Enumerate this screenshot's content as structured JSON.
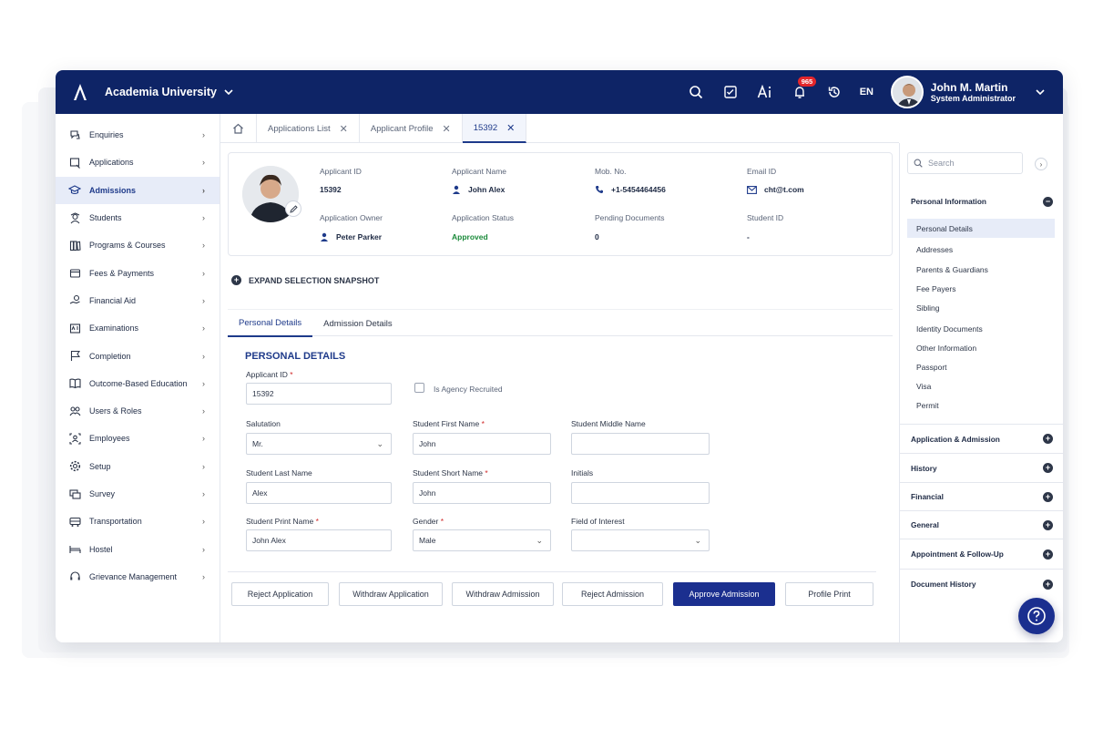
{
  "brand": {
    "name": "Academia University"
  },
  "header": {
    "lang": "EN",
    "notification_count": "965"
  },
  "user": {
    "name": "John M. Martin",
    "role": "System Administrator"
  },
  "sidebar": {
    "items": [
      {
        "label": "Enquiries",
        "icon": "enquiry-icon"
      },
      {
        "label": "Applications",
        "icon": "applications-icon"
      },
      {
        "label": "Admissions",
        "icon": "graduation-cap-icon",
        "active": true
      },
      {
        "label": "Students",
        "icon": "students-icon"
      },
      {
        "label": "Programs & Courses",
        "icon": "books-icon"
      },
      {
        "label": "Fees & Payments",
        "icon": "wallet-icon"
      },
      {
        "label": "Financial Aid",
        "icon": "hand-coin-icon"
      },
      {
        "label": "Examinations",
        "icon": "exam-icon"
      },
      {
        "label": "Completion",
        "icon": "flag-icon"
      },
      {
        "label": "Outcome-Based Education",
        "icon": "book-icon"
      },
      {
        "label": "Users & Roles",
        "icon": "users-icon"
      },
      {
        "label": "Employees",
        "icon": "employee-icon"
      },
      {
        "label": "Setup",
        "icon": "gear-icon"
      },
      {
        "label": "Survey",
        "icon": "survey-icon"
      },
      {
        "label": "Transportation",
        "icon": "bus-icon"
      },
      {
        "label": "Hostel",
        "icon": "bed-icon"
      },
      {
        "label": "Grievance Management",
        "icon": "headset-icon"
      }
    ]
  },
  "tabs": [
    {
      "label": "Applications List"
    },
    {
      "label": "Applicant Profile"
    },
    {
      "label": "15392",
      "active": true
    }
  ],
  "profile": {
    "applicant_id_label": "Applicant ID",
    "applicant_id": "15392",
    "applicant_name_label": "Applicant Name",
    "applicant_name": "John Alex",
    "mob_label": "Mob. No.",
    "mob": "+1-5454464456",
    "email_label": "Email ID",
    "email": "cht@t.com",
    "owner_label": "Application Owner",
    "owner": "Peter Parker",
    "status_label": "Application Status",
    "status": "Approved",
    "pending_label": "Pending Documents",
    "pending": "0",
    "student_id_label": "Student ID",
    "student_id": "-"
  },
  "expand_label": "EXPAND SELECTION SNAPSHOT",
  "subtabs": [
    {
      "label": "Personal Details",
      "active": true
    },
    {
      "label": "Admission Details"
    }
  ],
  "form": {
    "section_title": "PERSONAL DETAILS",
    "applicant_id_label": "Applicant ID",
    "applicant_id": "15392",
    "agency_label": "Is Agency Recruited",
    "salutation_label": "Salutation",
    "salutation": "Mr.",
    "first_name_label": "Student First Name",
    "first_name": "John",
    "middle_name_label": "Student Middle Name",
    "middle_name": "",
    "last_name_label": "Student Last Name",
    "last_name": "Alex",
    "short_name_label": "Student Short Name",
    "short_name": "John",
    "initials_label": "Initials",
    "initials": "",
    "print_name_label": "Student Print Name",
    "print_name": "John Alex",
    "gender_label": "Gender",
    "gender": "Male",
    "interest_label": "Field of Interest",
    "interest": "",
    "required_mark": "*"
  },
  "actions": {
    "reject_application": "Reject Application",
    "withdraw_application": "Withdraw Application",
    "withdraw_admission": "Withdraw Admission",
    "reject_admission": "Reject Admission",
    "approve_admission": "Approve Admission",
    "profile_print": "Profile Print"
  },
  "right_panel": {
    "search_placeholder": "Search",
    "personal_info": "Personal Information",
    "personal_items": [
      {
        "label": "Personal Details",
        "active": true
      },
      {
        "label": "Addresses"
      },
      {
        "label": "Parents & Guardians"
      },
      {
        "label": "Fee Payers"
      },
      {
        "label": "Sibling"
      },
      {
        "label": "Identity Documents"
      },
      {
        "label": "Other Information"
      },
      {
        "label": "Passport"
      },
      {
        "label": "Visa"
      },
      {
        "label": "Permit"
      }
    ],
    "sections": [
      {
        "label": "Application & Admission"
      },
      {
        "label": "History"
      },
      {
        "label": "Financial"
      },
      {
        "label": "General"
      },
      {
        "label": "Appointment & Follow-Up"
      },
      {
        "label": "Document History"
      }
    ]
  },
  "colors": {
    "navy": "#0e2466",
    "primary": "#1b2f8f",
    "approved": "#1a8a3a"
  }
}
